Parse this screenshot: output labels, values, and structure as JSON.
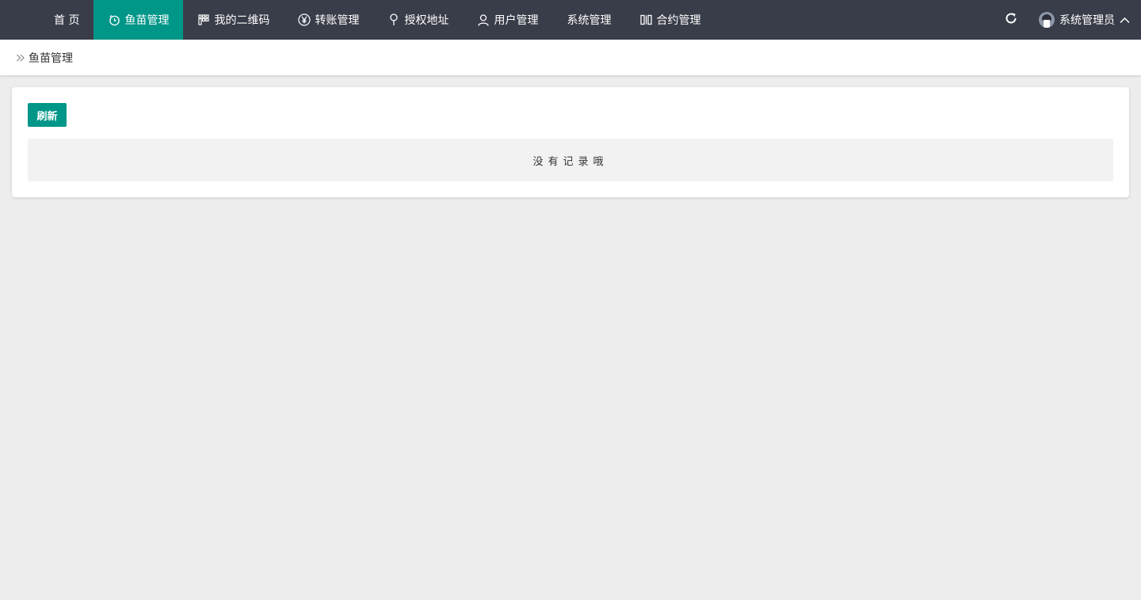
{
  "nav": {
    "items": [
      {
        "label": "首 页",
        "icon": "none"
      },
      {
        "label": "鱼苗管理",
        "icon": "timer-icon",
        "active": true
      },
      {
        "label": "我的二维码",
        "icon": "grid-icon"
      },
      {
        "label": "转账管理",
        "icon": "yen-icon"
      },
      {
        "label": "授权地址",
        "icon": "location-pin-icon"
      },
      {
        "label": "用户管理",
        "icon": "user-icon"
      },
      {
        "label": "系统管理",
        "icon": "none"
      },
      {
        "label": "合约管理",
        "icon": "contract-icon"
      }
    ]
  },
  "header": {
    "user_name": "系统管理员"
  },
  "breadcrumb": {
    "current": "鱼苗管理"
  },
  "toolbar": {
    "refresh_label": "刷新"
  },
  "table": {
    "empty_text": "没有记录哦"
  },
  "colors": {
    "topbar_bg": "#393d49",
    "accent": "#009688",
    "page_bg": "#ededed"
  }
}
